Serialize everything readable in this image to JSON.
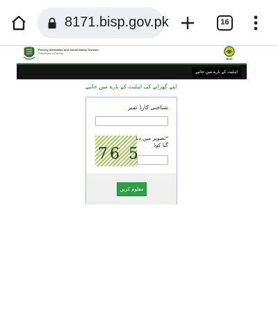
{
  "browser": {
    "url": "8171.bisp.gov.pk",
    "tab_count": "16",
    "icons": [
      "home-icon",
      "lock-icon",
      "plus-icon",
      "tabs-icon",
      "overflow-menu-icon"
    ]
  },
  "header": {
    "division_title": "Poverty Alleviation and Social Safety Division",
    "division_subtitle": "Government of Pakistan",
    "logo_text": "BISP"
  },
  "nav": {
    "item_label": "اہلیت کے بارے میں جانیے"
  },
  "page": {
    "heading": "اپنے گھرانے کی اہلیت کے بارے میں جانیے"
  },
  "form": {
    "cnic_label": "شناختی کارڈ نمبر",
    "cnic_value": "",
    "captcha_label": "تصویر میں دیا گیا کوڈ",
    "captcha_value": "",
    "captcha_text": "76 5?",
    "submit_label": "معلوم کریں"
  },
  "colors": {
    "brand_green": "#2f9e48",
    "heading_green": "#1d8a2e",
    "nav_background": "#151515",
    "panel_border": "#a8bfd6",
    "required": "#e02020"
  }
}
